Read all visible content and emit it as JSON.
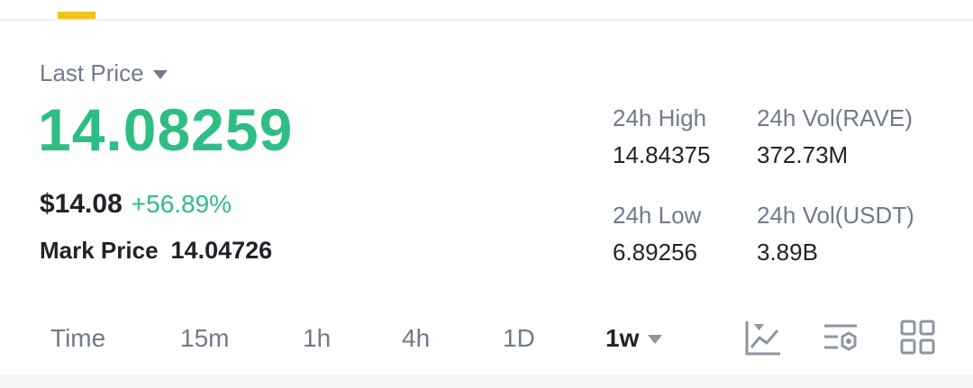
{
  "colors": {
    "accent": "#f0c419",
    "up": "#2ebd85",
    "muted": "#707a8a",
    "text": "#1e2329"
  },
  "header": {
    "last_price_label": "Last Price"
  },
  "price": {
    "last": "14.08259",
    "usd": "$14.08",
    "change": "+56.89%",
    "mark_label": "Mark Price",
    "mark_value": "14.04726"
  },
  "stats": {
    "high_label": "24h High",
    "high_value": "14.84375",
    "vol_base_label": "24h Vol(RAVE)",
    "vol_base_value": "372.73M",
    "low_label": "24h Low",
    "low_value": "6.89256",
    "vol_quote_label": "24h Vol(USDT)",
    "vol_quote_value": "3.89B"
  },
  "timeframes": {
    "time": "Time",
    "m15": "15m",
    "h1": "1h",
    "h4": "4h",
    "d1": "1D",
    "selected": "1w"
  },
  "icons": [
    "indicator-chart-icon",
    "chart-settings-icon",
    "grid-layout-icon"
  ]
}
